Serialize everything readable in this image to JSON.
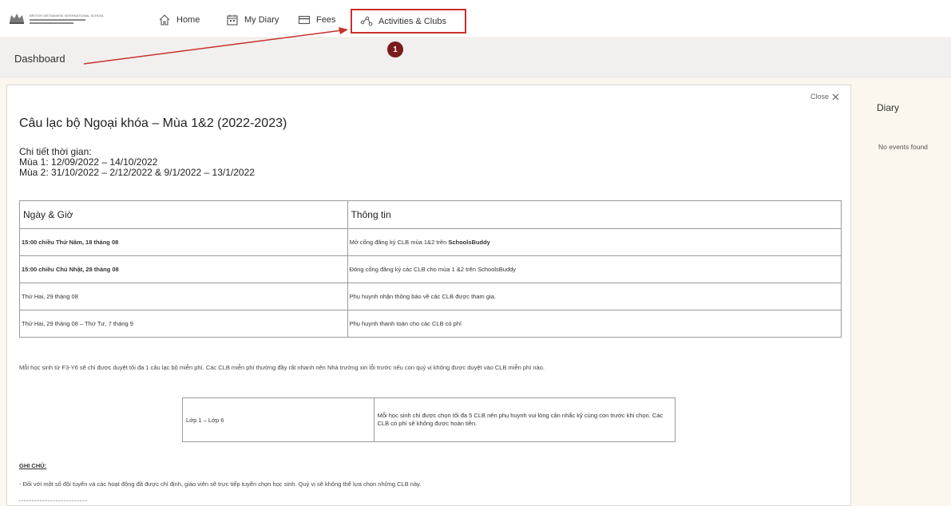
{
  "nav": {
    "logo_name": "BRITISH VIETNAMESE INTERNATIONAL SCHOOL",
    "items": [
      {
        "label": "Home",
        "icon": "home-icon"
      },
      {
        "label": "My Diary",
        "icon": "calendar-icon"
      },
      {
        "label": "Fees",
        "icon": "card-icon"
      },
      {
        "label": "Activities & Clubs",
        "icon": "network-icon"
      }
    ]
  },
  "dashboard": {
    "title": "Dashboard"
  },
  "annotation": {
    "badge": "1",
    "color": "#c8302b"
  },
  "content": {
    "close_label": "Close",
    "title": "Câu lạc bộ Ngoại khóa – Mùa 1&2 (2022-2023)",
    "time_heading": "Chi tiết thời gian:",
    "season1": "Mùa 1: 12/09/2022 – 14/10/2022",
    "season2": "Mùa 2: 31/10/2022 – 2/12/2022 & 9/1/2022 – 13/1/2022",
    "table": {
      "headers": [
        "Ngày & Giờ",
        "Thông tin"
      ],
      "rows": [
        {
          "date": "15:00 chiều Thứ Năm, 18 tháng 08",
          "info_prefix": "Mở cổng đăng ký CLB mùa 1&2 trên ",
          "info_bold": "SchoolsBuddy"
        },
        {
          "date": "15:00 chiều Chủ Nhật, 28 tháng 08",
          "info_prefix": "Đóng cổng đăng ký các CLB cho mùa 1 &2 trên SchoolsBuddy",
          "info_bold": ""
        },
        {
          "date": "Thứ Hai, 29 tháng 08",
          "info_prefix": "Phụ huynh nhận thông báo về các CLB được tham gia.",
          "info_bold": ""
        },
        {
          "date": "Thứ Hai, 29 tháng 08 – Thứ Tư, 7 tháng 9",
          "info_prefix": "Phụ huynh thanh toán cho các CLB có phí",
          "info_bold": ""
        }
      ]
    },
    "note1": "Mỗi học sinh từ F3-Y6 sẽ chỉ được duyệt tối đa 1 câu lạc bộ miễn phí. Các CLB miễn phí thường đầy rất nhanh nên Nhà trường xin lỗi trước nếu con quý vị không được duyệt vào CLB miễn phí nào.",
    "grade_table": {
      "grade": "Lớp 1 – Lớp 6",
      "rule": "Mỗi học sinh chỉ được chọn tối đa 5 CLB nên phụ huynh vui lòng cân nhắc kỹ cùng con trước khi chọn. Các CLB có phí sẽ không được hoàn tiền."
    },
    "ghichu_label": "GHI CHÚ:",
    "note2": "- Đối với một số đội tuyển và các hoạt động đã được chỉ định, giáo viên sẽ trực tiếp tuyển chọn học sinh. Quý vị sẽ không thể lựa chọn những CLB này."
  },
  "sidebar": {
    "title": "Diary",
    "empty": "No events found"
  }
}
